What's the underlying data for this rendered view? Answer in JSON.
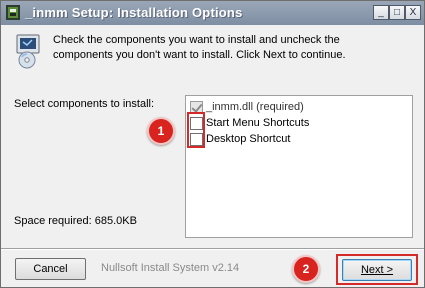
{
  "window": {
    "title": "_inmm Setup: Installation Options",
    "controls": {
      "minimize": "_",
      "maximize": "□",
      "close": "X"
    }
  },
  "header": {
    "line1": "Check the components you want to install and uncheck the",
    "line2": "components you don't want to install. Click Next to continue."
  },
  "components": {
    "label": "Select components to install:",
    "items": [
      {
        "label": "_inmm.dll (required)",
        "checked": true,
        "disabled": true
      },
      {
        "label": "Start Menu Shortcuts",
        "checked": false,
        "disabled": false
      },
      {
        "label": "Desktop Shortcut",
        "checked": false,
        "disabled": false
      }
    ]
  },
  "space_required": "Space required: 685.0KB",
  "footer": {
    "cancel_label": "Cancel",
    "brand": "Nullsoft Install System v2.14",
    "next_label": "Next >"
  },
  "annotations": {
    "badge1": "1",
    "badge2": "2",
    "color": "#d42a2a"
  }
}
